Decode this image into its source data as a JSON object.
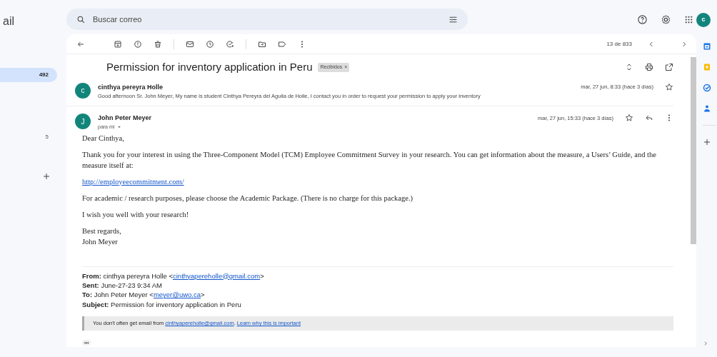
{
  "app": {
    "logo_text": "ail"
  },
  "search": {
    "placeholder": "Buscar correo"
  },
  "account": {
    "initial": "c"
  },
  "sidebar": {
    "items": [
      {
        "count": "492",
        "selected": true
      },
      {
        "count": "5",
        "selected": false
      }
    ]
  },
  "toolbar": {
    "position": "13 de 833"
  },
  "thread": {
    "subject": "Permission for inventory application in Peru",
    "label": "Recibidos",
    "label_close": "×",
    "messages": [
      {
        "kind": "collapsed",
        "sender": "cinthya pereyra Holle",
        "initial": "c",
        "color": "#12857b",
        "date": "mar, 27 jun, 8:33 (hace 3 días)",
        "snippet": "Good afternoon Sr. John Meyer, My name is student Cinthya Pereyra del Aguila de Holle, I contact you in order to request your permission to apply your inventory"
      },
      {
        "kind": "expanded",
        "sender": "John Peter Meyer",
        "initial": "J",
        "color": "#12857b",
        "recipient": "para mí",
        "date": "mar, 27 jun, 15:33 (hace 3 días)",
        "body": [
          {
            "kind": "text",
            "text": "Dear Cinthya,"
          },
          {
            "kind": "text",
            "text": "Thank you for your interest in using the Three-Component Model (TCM) Employee Commitment Survey in your research. You can get information about the measure, a Users’ Guide, and the measure itself at:"
          },
          {
            "kind": "link",
            "text": "http://employeecommitment.com/"
          },
          {
            "kind": "text",
            "text": "For academic / research purposes, please choose the Academic Package.  (There is no charge for this package.)"
          },
          {
            "kind": "text",
            "text": "I wish you well with your research!"
          },
          {
            "kind": "signature",
            "lines": [
              "Best regards,",
              "John Meyer"
            ]
          }
        ],
        "quoted_header": [
          {
            "label": "From:",
            "text": "cinthya pereyra Holle <",
            "link": "cinthyapereholle@gmail.com",
            "after": ">"
          },
          {
            "label": "Sent:",
            "text": "June-27-23 9:34 AM"
          },
          {
            "label": "To:",
            "text": "John Peter Meyer <",
            "link": "meyer@uwo.ca",
            "after": ">"
          },
          {
            "label": "Subject:",
            "text": "Permission for inventory application in Peru"
          }
        ],
        "notice": {
          "text": "You don't often get email from ",
          "link": "cinthyapereholle@gmail.com",
          "separator": ". ",
          "learn_link": "Learn why this is important"
        },
        "trimmed": "•••"
      }
    ]
  }
}
